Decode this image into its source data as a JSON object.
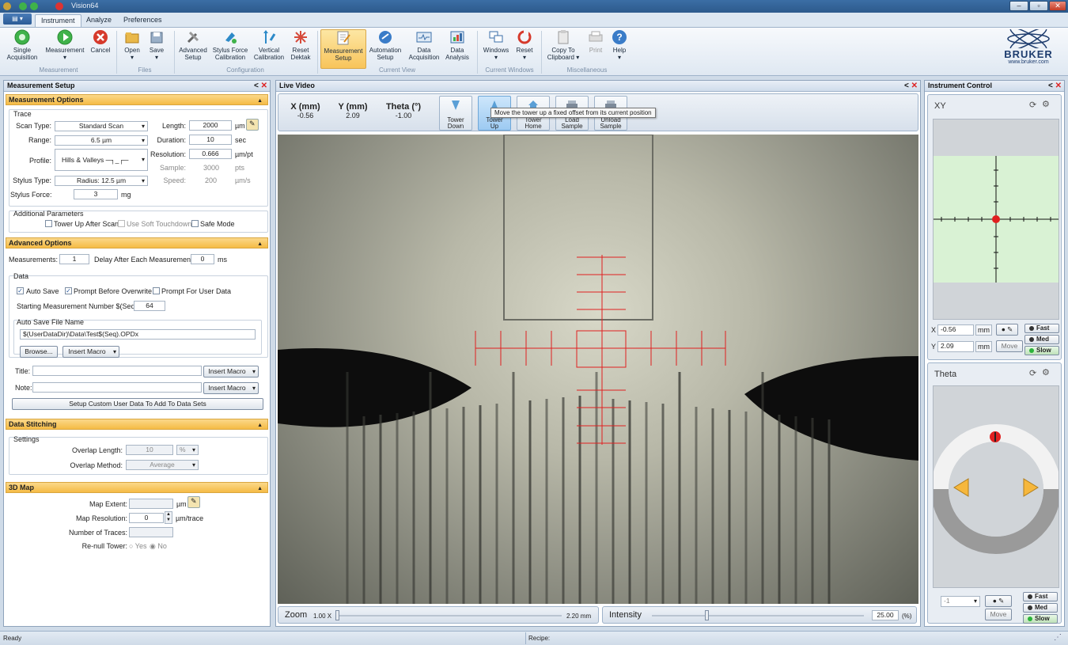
{
  "window": {
    "title": "Vision64"
  },
  "menu": {
    "file_label": "",
    "tabs": [
      {
        "label": "Instrument"
      },
      {
        "label": "Analyze"
      },
      {
        "label": "Preferences"
      }
    ]
  },
  "ribbon": {
    "buttons": {
      "single_acq": "Single\nAcquisition",
      "measurement": "Measurement",
      "cancel": "Cancel",
      "open": "Open",
      "save": "Save",
      "advanced_setup": "Advanced\nSetup",
      "stylus_force": "Stylus Force\nCalibration",
      "vertical_cal": "Vertical\nCalibration",
      "reset_dektak": "Reset\nDektak",
      "measurement_setup": "Measurement\nSetup",
      "automation_setup": "Automation\nSetup",
      "data_acq": "Data\nAcquisition",
      "data_analysis": "Data\nAnalysis",
      "windows": "Windows",
      "reset": "Reset",
      "copy_clipboard": "Copy To\nClipboard ▾",
      "print": "Print",
      "help": "Help"
    },
    "groups": {
      "measurement": "Measurement",
      "files": "Files",
      "configuration": "Configuration",
      "current_view": "Current View",
      "current_windows": "Current Windows",
      "misc": "Miscellaneous"
    },
    "brand": {
      "name": "BRUKER",
      "url": "www.bruker.com"
    }
  },
  "setup": {
    "title": "Measurement Setup",
    "options_header": "Measurement Options",
    "trace_legend": "Trace",
    "scan_type_label": "Scan Type:",
    "scan_type": "Standard Scan",
    "range_label": "Range:",
    "range": "6.5 µm",
    "profile_label": "Profile:",
    "profile": "Hills & Valleys",
    "stylus_type_label": "Stylus Type:",
    "stylus_type": "Radius: 12.5 µm",
    "stylus_force_label": "Stylus Force:",
    "stylus_force": "3",
    "stylus_force_unit": "mg",
    "length_label": "Length:",
    "length": "2000",
    "length_unit": "µm",
    "duration_label": "Duration:",
    "duration": "10",
    "duration_unit": "sec",
    "resolution_label": "Resolution:",
    "resolution": "0.666",
    "resolution_unit": "µm/pt",
    "sample_label": "Sample:",
    "sample": "3000",
    "sample_unit": "pts",
    "speed_label": "Speed:",
    "speed": "200",
    "speed_unit": "µm/s",
    "addl_legend": "Additional Parameters",
    "tower_up": "Tower Up After Scan",
    "soft_touch": "Use Soft Touchdown",
    "safe_mode": "Safe Mode"
  },
  "advanced": {
    "header": "Advanced Options",
    "measurements_label": "Measurements:",
    "measurements": "1",
    "delay_label": "Delay After Each Measurement:",
    "delay": "0",
    "delay_unit": "ms",
    "data_legend": "Data",
    "auto_save": "Auto Save",
    "prompt_overwrite": "Prompt Before Overwrite",
    "prompt_user": "Prompt For User Data",
    "start_num_label": "Starting Measurement Number $(Seq):",
    "start_num": "64",
    "autosave_legend": "Auto Save File Name",
    "file_name": "$(UserDataDir)\\Data\\Test$(Seq).OPDx",
    "browse": "Browse...",
    "insert_macro": "Insert Macro",
    "title_label": "Title:",
    "note_label": "Note:",
    "custom_btn": "Setup Custom User Data To Add To Data Sets"
  },
  "stitch": {
    "header": "Data Stitching",
    "settings_legend": "Settings",
    "overlap_len_label": "Overlap Length:",
    "overlap_len": "10",
    "overlap_unit": "%",
    "overlap_method_label": "Overlap Method:",
    "overlap_method": "Average"
  },
  "map3d": {
    "header": "3D Map",
    "extent_label": "Map Extent:",
    "extent_unit": "µm",
    "res_label": "Map Resolution:",
    "res": "0",
    "res_unit": "µm/trace",
    "traces_label": "Number of Traces:",
    "renull_label": "Re-null Tower:",
    "yes": "Yes",
    "no": "No"
  },
  "video": {
    "title": "Live Video",
    "x_label": "X (mm)",
    "x_val": "-0.56",
    "y_label": "Y (mm)",
    "y_val": "2.09",
    "theta_label": "Theta (°)",
    "theta_val": "-1.00",
    "tower_down": "Tower\nDown",
    "tower_up": "Tower\nUp",
    "tower_home": "Tower\nHome",
    "load_sample": "Load\nSample",
    "unload_sample": "Unload\nSample",
    "tooltip": "Move the tower up a fixed offset from its current position",
    "zoom_label": "Zoom",
    "zoom_min": "1.00 X",
    "zoom_max": "2.20 mm",
    "intensity_label": "Intensity",
    "intensity": "25.00",
    "intensity_unit": "(%)",
    "intensity_level": 0.25
  },
  "ictl": {
    "title": "Instrument Control",
    "xy_label": "XY",
    "x_prefix": "X",
    "x_val": "-0.56",
    "x_unit": "mm",
    "y_prefix": "Y",
    "y_val": "2.09",
    "y_unit": "mm",
    "move": "Move",
    "fast": "Fast",
    "med": "Med",
    "slow": "Slow",
    "theta_label": "Theta",
    "theta_val": "-1"
  },
  "status": {
    "left": "Ready",
    "recipe": "Recipe:"
  },
  "colors": {
    "accent": "#f5bb45",
    "crosshair": "#e02020",
    "xy_bg": "#d9f2d4"
  }
}
